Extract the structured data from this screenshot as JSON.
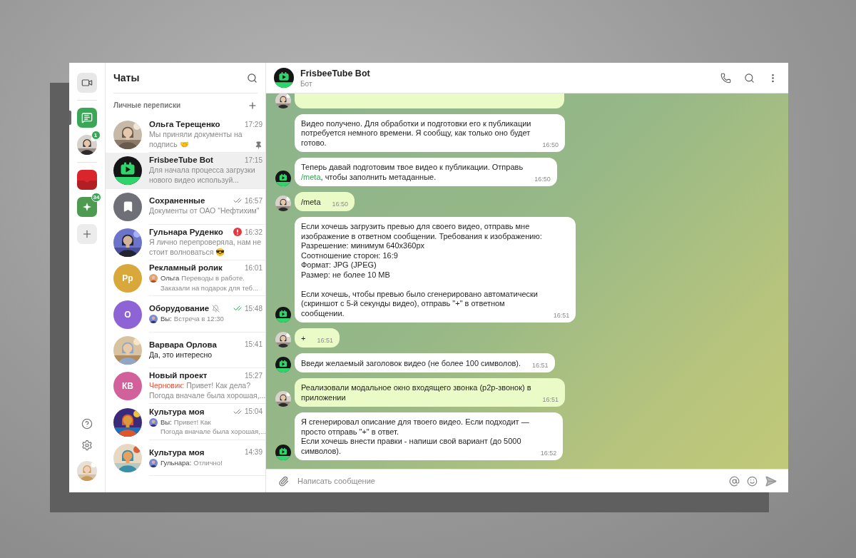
{
  "rail": {
    "groups": [
      [
        {
          "kind": "video",
          "selected": false
        }
      ],
      [
        {
          "kind": "chats",
          "selected": true
        },
        {
          "kind": "contact",
          "selected": false,
          "badge": "1"
        }
      ],
      [
        {
          "kind": "band",
          "color": "#d8262c",
          "selected": false
        },
        {
          "kind": "spark",
          "color": "#4e9a50",
          "selected": false,
          "badge": "34"
        },
        {
          "kind": "add",
          "selected": false
        }
      ]
    ],
    "bottom": [
      {
        "kind": "help"
      },
      {
        "kind": "settings"
      },
      {
        "kind": "profile"
      }
    ]
  },
  "chat_list": {
    "title": "Чаты",
    "section": "Личные переписки",
    "chats": [
      {
        "name": "Ольга Терещенко",
        "time": "17:29",
        "preview": "Мы приняли документы на\nподпись 🤝",
        "selected": false,
        "pinned": true,
        "read": false,
        "alert": false,
        "muted": false,
        "unread": false
      },
      {
        "name": "FrisbeeTube Bot",
        "time": "17:15",
        "preview": "Для начала процесса загрузки\nнового видео используй...",
        "avatar": {
          "kind": "bot"
        },
        "selected": true,
        "pinned": false,
        "read": false,
        "alert": false,
        "muted": false,
        "unread": false
      },
      {
        "name": "Сохраненные",
        "time": "16:57",
        "preview": "Документы от ОАО \"Нефтихим\"",
        "avatar": {
          "kind": "saved"
        },
        "selected": false,
        "pinned": false,
        "read": true,
        "alert": false,
        "muted": false,
        "unread": false
      },
      {
        "name": "Гульнара Руденко",
        "time": "16:32",
        "preview": "Я лично перепроверяла, нам не\nстоит волноваться 😎",
        "selected": false,
        "pinned": false,
        "read": false,
        "alert": true,
        "muted": false,
        "unread": false
      },
      {
        "name": "Рекламный ролик",
        "time": "16:01",
        "prefix": {
          "kind": "sender",
          "text": "Ольга"
        },
        "preview": "Переводы в работе.\nЗаказали на подарок для теб...",
        "avatar": {
          "kind": "initials",
          "text": "Рр",
          "color": "#d9a83a"
        },
        "selected": false,
        "pinned": false,
        "read": false,
        "alert": false,
        "muted": false,
        "unread": false
      },
      {
        "name": "Оборудование",
        "time": "15:48",
        "prefix": {
          "kind": "sender",
          "text": "Вы:"
        },
        "preview": "Встреча в 12:30",
        "avatar": {
          "kind": "initials",
          "text": "О",
          "color": "#8e63d6"
        },
        "selected": false,
        "pinned": false,
        "read": true,
        "alert": false,
        "muted": true,
        "unread": false
      },
      {
        "name": "Варвара Орлова",
        "time": "15:41",
        "preview": "Да, это интересно",
        "selected": false,
        "pinned": false,
        "read": false,
        "alert": false,
        "muted": false,
        "unread": true
      },
      {
        "name": "Новый проект",
        "time": "15:27",
        "prefix": {
          "kind": "draft",
          "text": "Черновик:"
        },
        "preview": "Привет! Как дела?\nПогода вначале была хорошая,...",
        "avatar": {
          "kind": "initials",
          "text": "КВ",
          "color": "#d2609a"
        },
        "selected": false,
        "pinned": false,
        "read": false,
        "alert": false,
        "muted": false,
        "unread": false
      },
      {
        "name": "Культура моя",
        "time": "15:04",
        "prefix": {
          "kind": "sender",
          "text": "Вы:"
        },
        "preview": "Привет! Как\nПогода вначале была хорошая,...",
        "selected": false,
        "pinned": false,
        "read": true,
        "alert": false,
        "muted": false,
        "unread": false
      },
      {
        "name": "Культура моя",
        "time": "14:39",
        "prefix": {
          "kind": "sender",
          "text": "Гульнара:"
        },
        "preview": "Отлично!",
        "selected": false,
        "pinned": false,
        "read": false,
        "alert": false,
        "muted": false,
        "unread": false
      }
    ]
  },
  "chat": {
    "title": "FrisbeeTube Bot",
    "subtitle": "Бот",
    "messages": [
      {
        "kind": "user",
        "avatar": true
      },
      {
        "kind": "bot",
        "avatar": false,
        "time": "16:50",
        "parts": [
          {
            "kind": "plain",
            "text": "Видео получено. Для обработки и подготовки его к публикации\nпотребуется немного времени. Я сообщу, как только оно будет\nготово."
          }
        ]
      },
      {
        "kind": "bot",
        "avatar": true,
        "time": "16:50",
        "parts": [
          {
            "kind": "plain",
            "text": "Теперь давай подготовим твое видео к публикации. Отправь\n"
          },
          {
            "kind": "command",
            "text": "/meta"
          },
          {
            "kind": "plain",
            "text": ", чтобы заполнить метаданные."
          }
        ]
      },
      {
        "kind": "user",
        "avatar": true,
        "time": "16:50",
        "parts": [
          {
            "kind": "plain",
            "text": "/meta"
          }
        ]
      },
      {
        "kind": "bot",
        "avatar": true,
        "time": "16:51",
        "parts": [
          {
            "kind": "plain",
            "text": "Если хочешь загрузить превью для своего видео, отправь мне\nизображение в ответном сообщении. Требования к изображению:\nРазрешение: минимум 640x360px\nСоотношение сторон: 16:9\nФормат: JPG (JPEG)\nРазмер: не более 10 MB\n\nЕсли хочешь, чтобы превью было сгенерировано автоматически\n(скриншот с 5-й секунды видео), отправь \"+\" в ответном\nсообщении."
          }
        ]
      },
      {
        "kind": "user",
        "avatar": true,
        "time": "16:51",
        "parts": [
          {
            "kind": "plain",
            "text": "+"
          }
        ]
      },
      {
        "kind": "bot",
        "avatar": true,
        "time": "16:51",
        "parts": [
          {
            "kind": "plain",
            "text": "Введи желаемый заголовок видео (не более 100 символов)."
          }
        ]
      },
      {
        "kind": "user",
        "avatar": true,
        "time": "16:51",
        "parts": [
          {
            "kind": "plain",
            "text": "Реализовали модальное окно входящего звонка (p2p-звонок) в\nприложении"
          }
        ]
      },
      {
        "kind": "bot",
        "avatar": true,
        "time": "16:52",
        "parts": [
          {
            "kind": "plain",
            "text": "Я сгенерировал описание для твоего видео. Если подходит —\nпросто отправь \"+\" в ответ.\nЕсли хочешь внести правки - напиши свой вариант (до 5000\nсимволов)."
          }
        ]
      }
    ],
    "composer": {
      "placeholder": "Написать сообщение"
    }
  }
}
